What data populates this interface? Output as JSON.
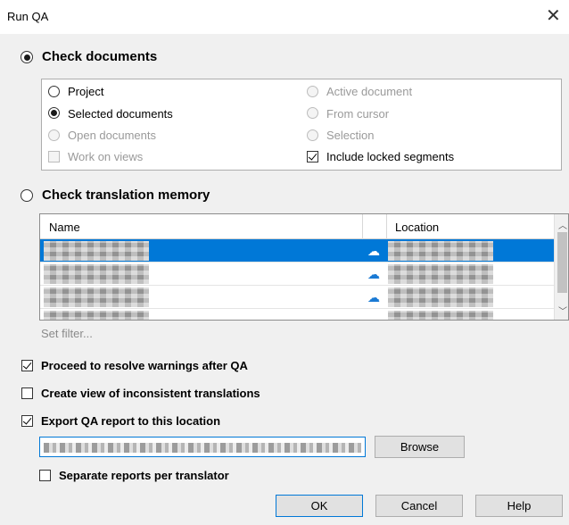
{
  "window": {
    "title": "Run QA"
  },
  "check_documents": {
    "label": "Check documents",
    "options": {
      "project": "Project",
      "selected_documents": "Selected documents",
      "open_documents": "Open documents",
      "work_on_views": "Work on views",
      "active_document": "Active document",
      "from_cursor": "From cursor",
      "selection": "Selection",
      "include_locked": "Include locked segments"
    }
  },
  "check_tm": {
    "label": "Check translation memory",
    "columns": {
      "name": "Name",
      "location": "Location"
    },
    "rows": [
      {
        "icon": "cloud-icon",
        "selected": true
      },
      {
        "icon": "cloud-icon",
        "selected": false
      },
      {
        "icon": "cloud-icon",
        "selected": false
      },
      {
        "icon": "cloud-icon",
        "selected": false
      }
    ],
    "set_filter": "Set filter..."
  },
  "options": {
    "proceed_resolve": "Proceed to resolve warnings after QA",
    "create_view": "Create view of inconsistent translations",
    "export_report": "Export QA report to this location",
    "separate_reports": "Separate reports per translator"
  },
  "buttons": {
    "browse": "Browse",
    "ok": "OK",
    "cancel": "Cancel",
    "help": "Help"
  },
  "colors": {
    "selection": "#0078d7",
    "background": "#f0f0f0"
  }
}
